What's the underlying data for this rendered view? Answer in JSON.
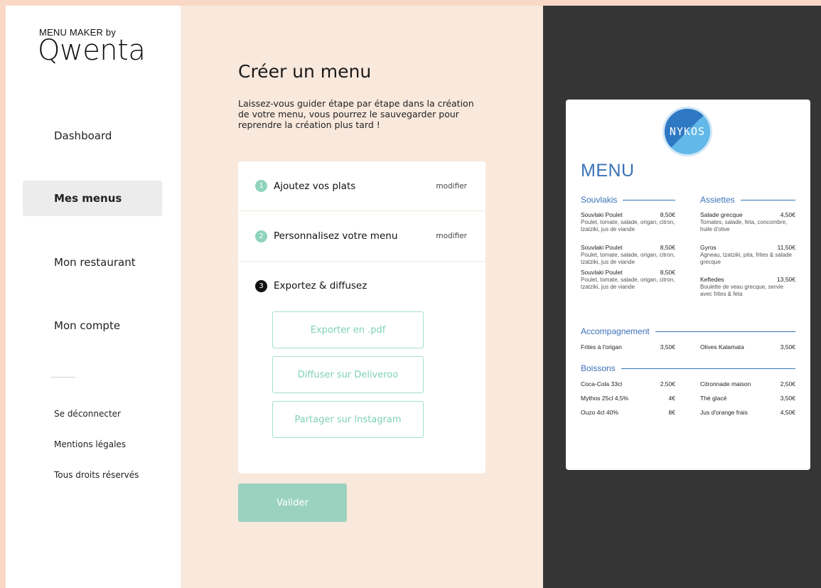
{
  "brand": {
    "small": "MENU MAKER by",
    "name": "Qwenta"
  },
  "nav": [
    {
      "label": "Dashboard",
      "active": false
    },
    {
      "label": "Mes menus",
      "active": true
    },
    {
      "label": "Mon restaurant",
      "active": false
    },
    {
      "label": "Mon compte",
      "active": false
    }
  ],
  "footer_links": [
    "Se déconnecter",
    "Mentions légales",
    "Tous droits réservés"
  ],
  "page": {
    "title": "Créer un menu",
    "intro": "Laissez-vous guider étape par étape dans la création de votre menu, vous pourrez le sauvegarder pour reprendre la création plus tard !"
  },
  "steps": [
    {
      "num": "1",
      "label": "Ajoutez vos plats",
      "edit": "modifier",
      "status": "done"
    },
    {
      "num": "2",
      "label": "Personnalisez votre menu",
      "edit": "modifier",
      "status": "done"
    },
    {
      "num": "3",
      "label": "Exportez & diffusez",
      "edit": "",
      "status": "current"
    }
  ],
  "export_actions": [
    "Exporter en .pdf",
    "Diffuser sur Deliveroo",
    "Partager sur Instagram"
  ],
  "validate_label": "Valider",
  "preview": {
    "logo_text": "NYKOS",
    "title": "MENU",
    "sections": {
      "souvlakis": {
        "title": "Souvlakis",
        "items": [
          {
            "name": "Souvlaki Poulet",
            "price": "8,50€",
            "desc": "Poulet, tomate, salade, origan, citron, tzatziki, jus de viande"
          },
          {
            "name": "Souvlaki Poulet",
            "price": "8,50€",
            "desc": "Poulet, tomate, salade, origan, citron, tzatziki, jus de viande"
          },
          {
            "name": "Souvlaki Poulet",
            "price": "8,50€",
            "desc": "Poulet, tomate, salade, origan, citron, tzatziki, jus de viande"
          }
        ]
      },
      "assiettes": {
        "title": "Assiettes",
        "items": [
          {
            "name": "Salade grecque",
            "price": "4,50€",
            "desc": "Tomates, salade, feta, concombre, huile d'olive"
          },
          {
            "name": "Gyros",
            "price": "11,50€",
            "desc": "Agneau, tzatziki, pita, frites & salade grecque"
          },
          {
            "name": "Keftedes",
            "price": "13,50€",
            "desc": "Boulette de veau grecque, servie avec frites & feta"
          }
        ]
      },
      "accompagnement": {
        "title": "Accompagnement",
        "items": [
          {
            "name": "Frites à l'origan",
            "price": "3,50€"
          },
          {
            "name": "Olives Kalamata",
            "price": "3,50€"
          }
        ]
      },
      "boissons": {
        "title": "Boissons",
        "left": [
          {
            "name": "Coca-Cola 33cl",
            "price": "2,50€"
          },
          {
            "name": "Mythos 25cl 4,5%",
            "price": "4€"
          },
          {
            "name": "Ouzo 4cl 40%",
            "price": "8€"
          }
        ],
        "right": [
          {
            "name": "Citronnade maison",
            "price": "2,50€"
          },
          {
            "name": "Thé glacé",
            "price": "3,50€"
          },
          {
            "name": "Jus d'orange frais",
            "price": "4,50€"
          }
        ]
      }
    }
  }
}
